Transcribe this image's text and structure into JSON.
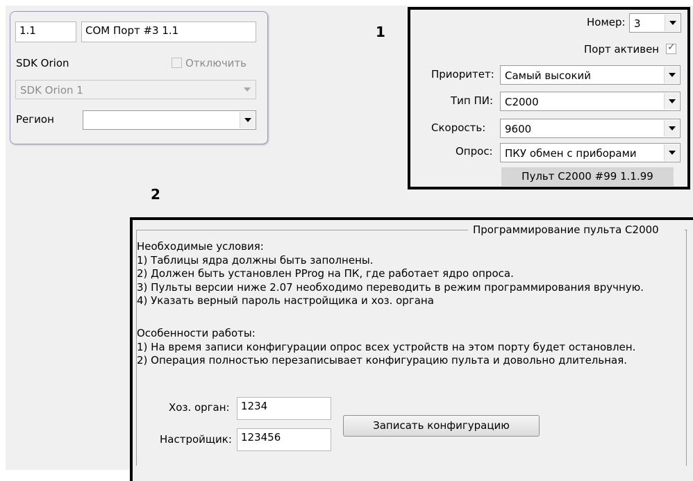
{
  "left_panel": {
    "code_value": "1.1",
    "name_value": "COM Порт #3 1.1",
    "sdk_label": "SDK Orion",
    "disable_label": "Отключить",
    "sdk_select_value": "SDK Orion 1",
    "region_label": "Регион",
    "region_value": ""
  },
  "markers": {
    "one": "1",
    "two": "2"
  },
  "port_settings": {
    "number_label": "Номер:",
    "number_value": "3",
    "active_label": "Порт активен",
    "active_checked": true,
    "priority_label": "Приоритет:",
    "priority_value": "Самый высокий",
    "type_label": "Тип ПИ:",
    "type_value": "С2000",
    "speed_label": "Скорость:",
    "speed_value": "9600",
    "poll_label": "Опрос:",
    "poll_value": "ПКУ обмен с приборами",
    "pult_label": "Пульт С2000 #99 1.1.99"
  },
  "programming": {
    "group_title": "Программирование пульта С2000",
    "lines": [
      "Необходимые условия:",
      "1) Таблицы ядра должны быть заполнены.",
      "2) Должен быть установлен PProg на ПК, где работает ядро опроса.",
      "3) Пульты версии ниже 2.07 необходимо переводить в режим программирования вручную.",
      "4) Указать верный пароль настройщика и хоз. органа",
      "",
      "Особенности работы:",
      "1) На время записи конфигурации опрос всех устройств на этом порту будет остановлен.",
      "2) Операция полностью перезаписывает конфигурацию пульта и довольно длительная."
    ],
    "owner_label": "Хоз. орган:",
    "owner_value": "1234",
    "installer_label": "Настройщик:",
    "installer_value": "123456",
    "write_button": "Записать конфигурацию"
  }
}
